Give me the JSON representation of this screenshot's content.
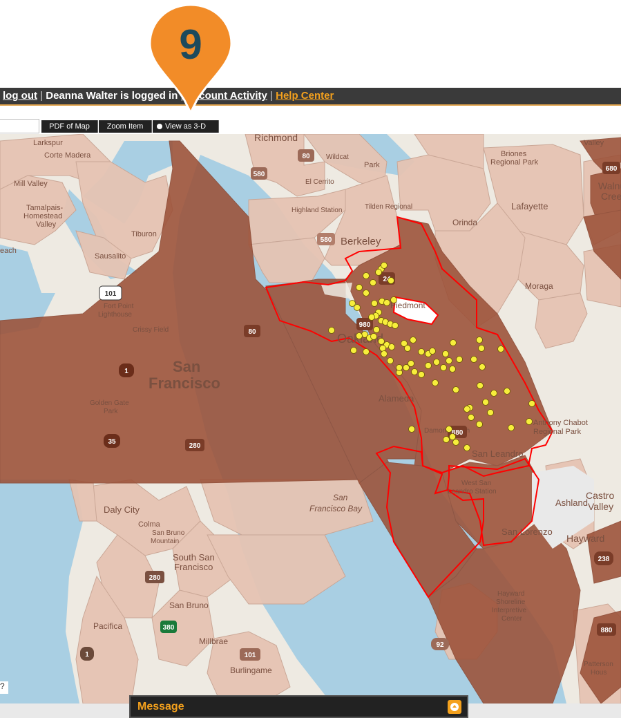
{
  "callout": {
    "number": "9",
    "color": "#f28c28"
  },
  "topbar": {
    "logout": "log out",
    "logged_in_text": "Deanna Walter is logged in",
    "account_activity": "Account Activity",
    "help_center": "Help Center",
    "separator": "|"
  },
  "toolbar": {
    "pdf": "PDF of Map",
    "zoom": "Zoom Item",
    "view3d": "View as 3-D"
  },
  "map": {
    "place_labels": [
      {
        "id": "richmond",
        "text": "Richmond"
      },
      {
        "id": "berkeley",
        "text": "Berkeley"
      },
      {
        "id": "oakland",
        "text": "Oakland"
      },
      {
        "id": "sf1",
        "text": "San"
      },
      {
        "id": "sf2",
        "text": "Francisco"
      },
      {
        "id": "alameda",
        "text": "Alameda"
      },
      {
        "id": "sanleandro",
        "text": "San Leandro"
      },
      {
        "id": "lafayette",
        "text": "Lafayette"
      },
      {
        "id": "orinda",
        "text": "Orinda"
      },
      {
        "id": "moraga",
        "text": "Moraga"
      },
      {
        "id": "piedmont",
        "text": "Piedmont"
      },
      {
        "id": "ashland",
        "text": "Ashland"
      },
      {
        "id": "castro",
        "text": "Castro"
      },
      {
        "id": "valley",
        "text": "Valley"
      },
      {
        "id": "sanlorenzo",
        "text": "San Lorenzo"
      },
      {
        "id": "hayward",
        "text": "Hayward"
      },
      {
        "id": "dalycity",
        "text": "Daly City"
      },
      {
        "id": "colma",
        "text": "Colma"
      },
      {
        "id": "ssf1",
        "text": "South San"
      },
      {
        "id": "ssf2",
        "text": "Francisco"
      },
      {
        "id": "sanbruno",
        "text": "San Bruno"
      },
      {
        "id": "pacifica",
        "text": "Pacifica"
      },
      {
        "id": "millbrae",
        "text": "Millbrae"
      },
      {
        "id": "burlingame",
        "text": "Burlingame"
      },
      {
        "id": "tiburon",
        "text": "Tiburon"
      },
      {
        "id": "sausalito",
        "text": "Sausalito"
      },
      {
        "id": "millvalley",
        "text": "Mill Valley"
      },
      {
        "id": "tamalpais",
        "text": "Tamalpais-"
      },
      {
        "id": "homestead",
        "text": "Homestead"
      },
      {
        "id": "valley2",
        "text": "Valley"
      },
      {
        "id": "cortemadera",
        "text": "Corte Madera"
      },
      {
        "id": "briones1",
        "text": "Briones"
      },
      {
        "id": "briones2",
        "text": "Regional Park"
      },
      {
        "id": "anthony1",
        "text": "Anthony Chabot"
      },
      {
        "id": "anthony2",
        "text": "Regional Park"
      },
      {
        "id": "alamedaislands",
        "text": "Damon Slough"
      },
      {
        "id": "westsl1",
        "text": "West San"
      },
      {
        "id": "westsl2",
        "text": "Leandro Station"
      },
      {
        "id": "sfbay1",
        "text": "San"
      },
      {
        "id": "sfbay2",
        "text": "Francisco Bay"
      },
      {
        "id": "highland",
        "text": "Highland Station"
      },
      {
        "id": "tilden",
        "text": "Tilden Regional"
      },
      {
        "id": "elcerrito",
        "text": "El Cerrito"
      },
      {
        "id": "fortpoint1",
        "text": "Fort Point"
      },
      {
        "id": "fortpoint2",
        "text": "Lighthouse"
      },
      {
        "id": "crissy",
        "text": "Crissy Field"
      },
      {
        "id": "goldengate1",
        "text": "Golden Gate"
      },
      {
        "id": "goldengate2",
        "text": "Park"
      },
      {
        "id": "hshore1",
        "text": "Hayward"
      },
      {
        "id": "hshore2",
        "text": "Shoreline"
      },
      {
        "id": "hshore3",
        "text": "Interpretive"
      },
      {
        "id": "hshore4",
        "text": "Center"
      },
      {
        "id": "sanbrunomtn1",
        "text": "San Bruno"
      },
      {
        "id": "sanbrunomtn2",
        "text": "Mountain"
      },
      {
        "id": "beach",
        "text": "each"
      },
      {
        "id": "park",
        "text": "Park"
      },
      {
        "id": "larkspur",
        "text": "Larkspur"
      },
      {
        "id": "walnut1",
        "text": "Walnu"
      },
      {
        "id": "walnut2",
        "text": "Cree"
      },
      {
        "id": "patterson1",
        "text": "Patterson"
      },
      {
        "id": "patterson2",
        "text": "Hous"
      },
      {
        "id": "valley_top",
        "text": "Valley"
      },
      {
        "id": "wildcat",
        "text": "Wildcat"
      }
    ],
    "highway_shields": [
      "580",
      "80",
      "580",
      "24",
      "101",
      "80",
      "1",
      "35",
      "280",
      "880",
      "238",
      "92",
      "880",
      "280",
      "101",
      "380",
      "1",
      "680",
      "980"
    ],
    "colors": {
      "water": "#a9cfe3",
      "land": "#eeeae2",
      "zone_dark": "#9c5138",
      "zone_light": "#e6c4b3",
      "selection_border": "#ff0000",
      "points": "#f7ee3c"
    }
  }
}
